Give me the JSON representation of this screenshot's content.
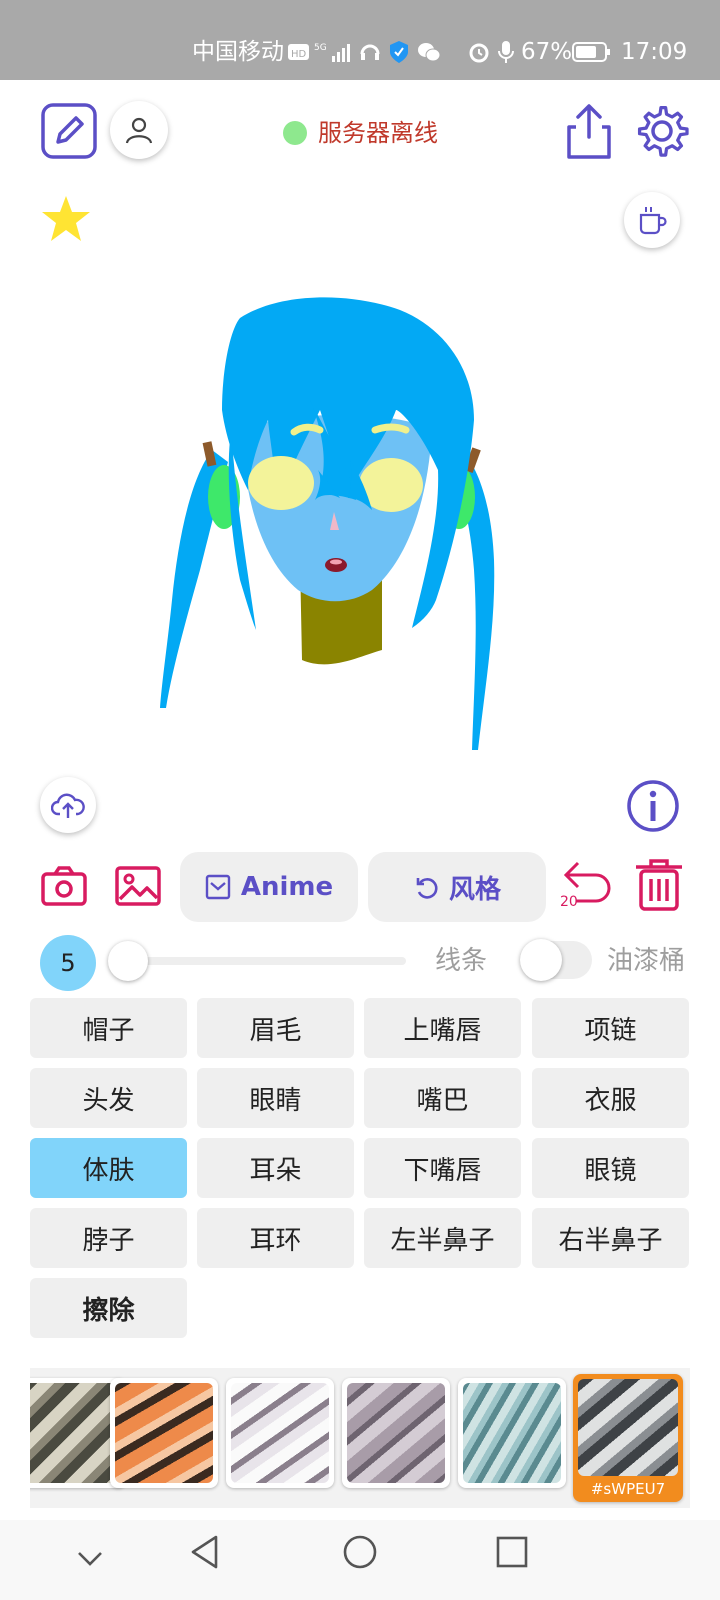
{
  "status_bar": {
    "carrier": "中国移动",
    "battery": "67%",
    "time": "17:09"
  },
  "header": {
    "server_status": "服务器离线",
    "server_status_color": "#8ee88e"
  },
  "toolbar": {
    "anime_label": "Anime",
    "style_label": "风格",
    "undo_count": "20"
  },
  "brush": {
    "size": "5",
    "size_level": 0.0,
    "line_label": "线条",
    "bucket_label": "油漆桶",
    "bucket_enabled": false
  },
  "parts": [
    {
      "label": "帽子"
    },
    {
      "label": "眉毛"
    },
    {
      "label": "上嘴唇"
    },
    {
      "label": "项链"
    },
    {
      "label": "头发"
    },
    {
      "label": "眼睛"
    },
    {
      "label": "嘴巴"
    },
    {
      "label": "衣服"
    },
    {
      "label": "体肤"
    },
    {
      "label": "耳朵"
    },
    {
      "label": "下嘴唇"
    },
    {
      "label": "眼镜"
    },
    {
      "label": "脖子"
    },
    {
      "label": "耳环"
    },
    {
      "label": "左半鼻子"
    },
    {
      "label": "右半鼻子"
    },
    {
      "label": "擦除"
    }
  ],
  "selected_part": "体肤",
  "textures": {
    "selected_code": "#sWPEU7"
  },
  "colors": {
    "accent": "#5b4fc6",
    "danger": "#d81b60",
    "active": "#81d4fa",
    "hair": "#03a9f4",
    "skin": "#6ec1f5",
    "neck": "#8a8400"
  }
}
